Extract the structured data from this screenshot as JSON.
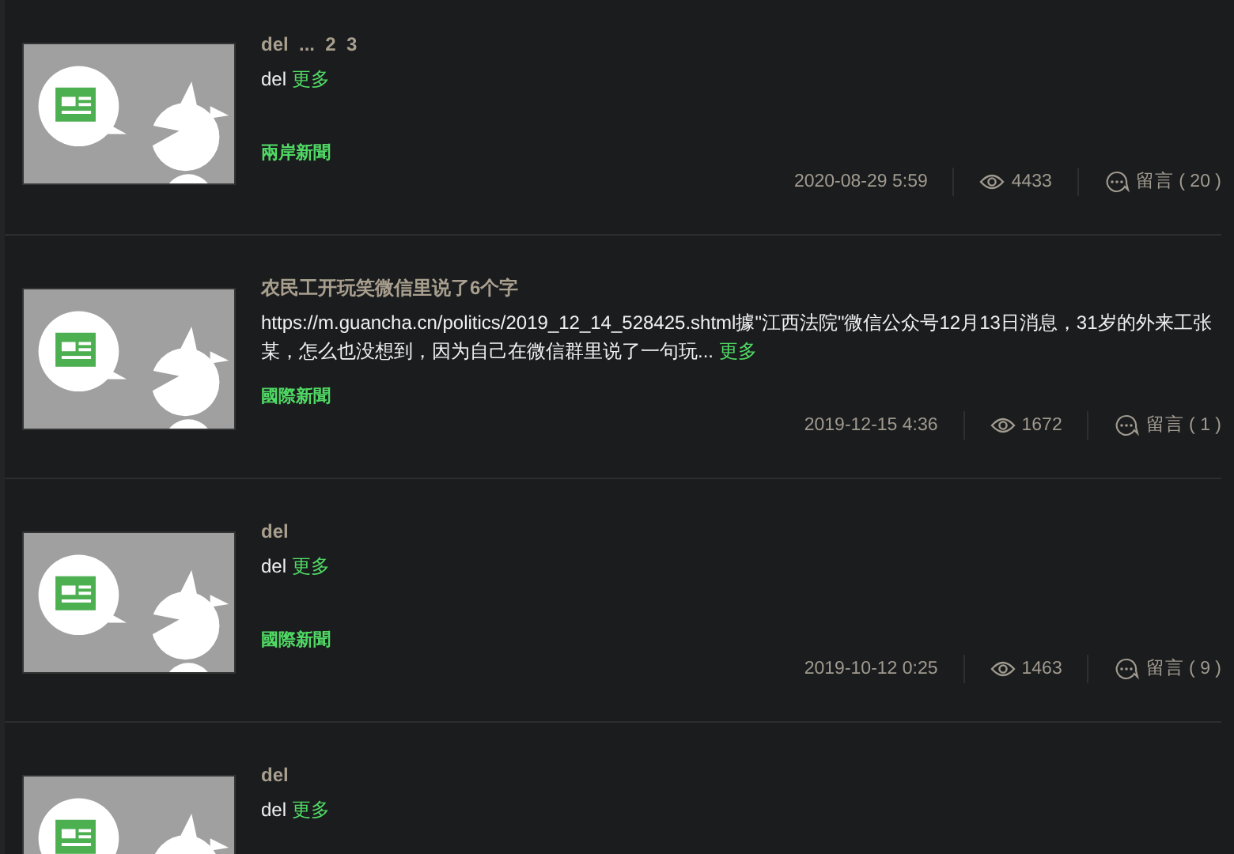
{
  "posts": [
    {
      "title": "del  ...  2  3",
      "body": "del",
      "more": "更多",
      "category": "兩岸新聞",
      "date": "2020-08-29 5:59",
      "views": "4433",
      "comments_label": "留言 ( 20 )"
    },
    {
      "title": "农民工开玩笑微信里说了6个字",
      "body": "https://m.guancha.cn/politics/2019_12_14_528425.shtml據\"江西法院\"微信公众号12月13日消息，31岁的外来工张某，怎么也没想到，因为自己在微信群里说了一句玩...",
      "more": "更多",
      "category": "國際新聞",
      "date": "2019-12-15 4:36",
      "views": "1672",
      "comments_label": "留言 ( 1 )"
    },
    {
      "title": "del",
      "body": "del",
      "more": "更多",
      "category": "國際新聞",
      "date": "2019-10-12 0:25",
      "views": "1463",
      "comments_label": "留言 ( 9 )"
    },
    {
      "title": "del",
      "body": "del",
      "more": "更多"
    }
  ]
}
